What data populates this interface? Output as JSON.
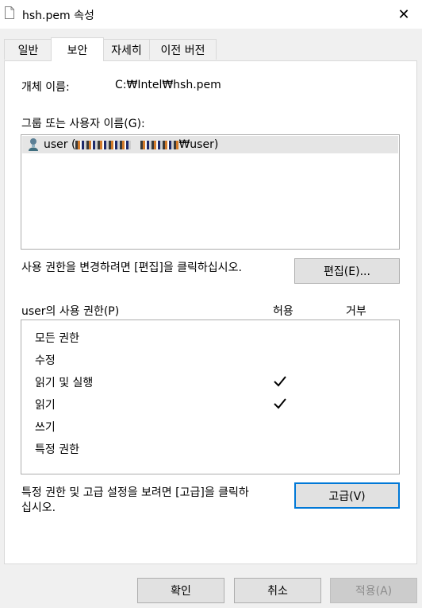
{
  "window": {
    "title": "hsh.pem 속성",
    "close_glyph": "✕"
  },
  "tabs": [
    {
      "label": "일반"
    },
    {
      "label": "보안"
    },
    {
      "label": "자세히"
    },
    {
      "label": "이전 버전"
    }
  ],
  "active_tab": 1,
  "object": {
    "label": "개체 이름:",
    "value": "C:₩Intel₩hsh.pem"
  },
  "groups": {
    "label": "그룹 또는 사용자 이름(G):",
    "items": [
      {
        "prefix": "user (",
        "suffix": "₩user)"
      }
    ]
  },
  "edit": {
    "hint": "사용 권한을 변경하려면 [편집]을 클릭하십시오.",
    "button": "편집(E)..."
  },
  "permissions": {
    "title": "user의 사용 권한(P)",
    "allow_header": "허용",
    "deny_header": "거부",
    "rows": [
      {
        "name": "모든 권한",
        "allow": false,
        "deny": false
      },
      {
        "name": "수정",
        "allow": false,
        "deny": false
      },
      {
        "name": "읽기 및 실행",
        "allow": true,
        "deny": false
      },
      {
        "name": "읽기",
        "allow": true,
        "deny": false
      },
      {
        "name": "쓰기",
        "allow": false,
        "deny": false
      },
      {
        "name": "특정 권한",
        "allow": false,
        "deny": false
      }
    ]
  },
  "advanced": {
    "hint_line1": "특정 권한 및 고급 설정을 보려면 [고급]을 클릭하",
    "hint_line2": "십시오.",
    "button": "고급(V)"
  },
  "footer": {
    "ok": "확인",
    "cancel": "취소",
    "apply": "적용(A)"
  },
  "colors": {
    "focus_border": "#0078d7",
    "selection": "#e5e5e5"
  }
}
